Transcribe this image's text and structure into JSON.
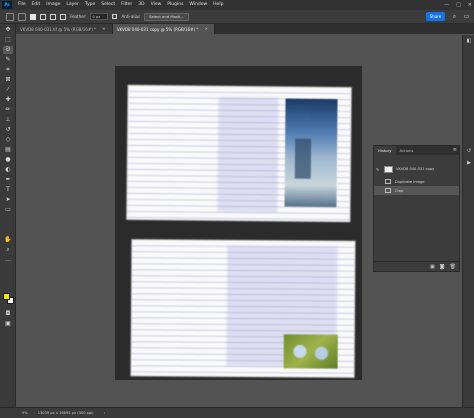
{
  "app": {
    "logo": "Ps"
  },
  "menu": [
    "File",
    "Edit",
    "Image",
    "Layer",
    "Type",
    "Select",
    "Filter",
    "3D",
    "View",
    "Plugins",
    "Window",
    "Help"
  ],
  "window_controls": [
    "—",
    "□",
    "✕"
  ],
  "options_bar": {
    "feather_label": "Feather:",
    "feather_value": "0 px",
    "anti_alias_label": "Anti-alias",
    "select_mask_label": "Select and Mask..."
  },
  "share_label": "Share",
  "tabs": [
    {
      "label": "VKVD8 040-031.tif @ 5% (RGB/16#) *",
      "close": "×"
    },
    {
      "label": "VKVD8 040-031 copy @ 5% (RGB/16#) *",
      "close": "×"
    }
  ],
  "history_panel": {
    "tabs": [
      "History",
      "Actions"
    ],
    "snapshot_label": "VKVD8 040-031 copy",
    "steps": [
      "Duplicate Image",
      "Crop"
    ],
    "menu_icon": "≡"
  },
  "status_bar": {
    "zoom": "5%",
    "doc_info": "13039 px x 16895 px (300 ppi)",
    "arrow": "›"
  },
  "colors": {
    "accent": "#1473e6",
    "foreground": "#f2e600",
    "background": "#ffffff"
  },
  "icons": {
    "tools": [
      "move-icon",
      "marquee-icon",
      "lasso-icon",
      "quick-select-icon",
      "crop-icon",
      "frame-icon",
      "eyedropper-icon",
      "healing-icon",
      "brush-icon",
      "clone-stamp-icon",
      "history-brush-icon",
      "eraser-icon",
      "gradient-icon",
      "blur-icon",
      "dodge-icon",
      "pen-icon",
      "type-icon",
      "path-select-icon",
      "rectangle-icon",
      "hand-icon",
      "zoom-icon",
      "more-tools-icon"
    ]
  }
}
